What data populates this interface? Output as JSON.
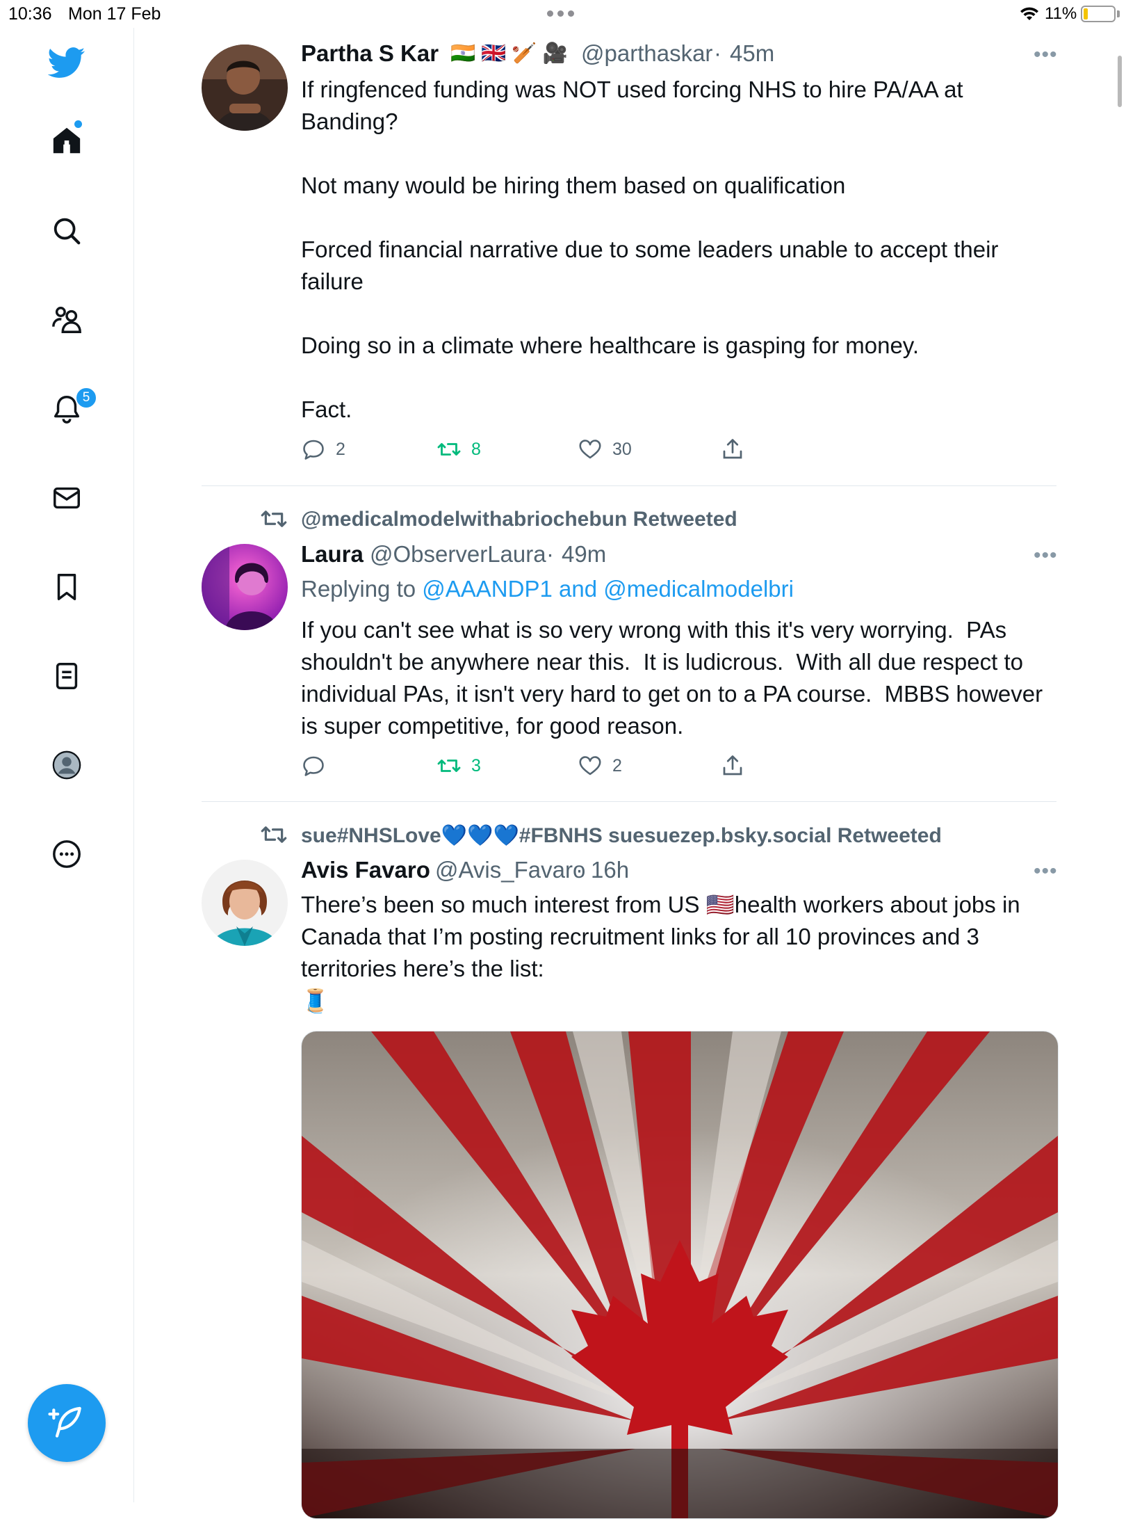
{
  "status_bar": {
    "time": "10:36",
    "date": "Mon 17 Feb",
    "battery": "11%"
  },
  "sidebar": {
    "items": [
      {
        "name": "home-icon"
      },
      {
        "name": "search-icon"
      },
      {
        "name": "communities-icon"
      },
      {
        "name": "notifications-icon",
        "badge": "5"
      },
      {
        "name": "messages-icon"
      },
      {
        "name": "bookmarks-icon"
      },
      {
        "name": "lists-icon"
      },
      {
        "name": "profile-icon"
      },
      {
        "name": "more-icon"
      }
    ],
    "notification_badge": "5"
  },
  "tweets": [
    {
      "name": "Partha S Kar",
      "name_emojis": "🇮🇳 🇬🇧 🏏 🎥",
      "handle": "@parthaskar",
      "time": "45m",
      "text": "If ringfenced funding was NOT used forcing NHS to hire PA/AA at Banding?\n\nNot many would be hiring them based on qualification\n\nForced financial narrative due to some leaders unable to accept their failure\n\nDoing so in a climate where healthcare is gasping for money.\n\nFact.",
      "replies": "2",
      "retweets": "8",
      "likes": "30"
    },
    {
      "retweeted_by": "@medicalmodelwithabriochebun Retweeted",
      "name": "Laura",
      "handle": "@ObserverLaura",
      "time": "49m",
      "replying_prefix": "Replying to ",
      "replying_to": "@AAANDP1 and @medicalmodelbri",
      "text": "If you can't see what is so very wrong with this it's very worrying.  PAs shouldn't be anywhere near this.  It is ludicrous.  With all due respect to individual PAs, it isn't very hard to get on to a PA course.  MBBS however is super competitive, for good reason.",
      "replies": "",
      "retweets": "3",
      "likes": "2"
    },
    {
      "retweeted_by": "sue#NHSLove💙💙💙#FBNHS suesuezep.bsky.social Retweeted",
      "name": "Avis Favaro",
      "handle": "@Avis_Favaro",
      "time": "16h",
      "text_a": "There’s been so much interest from US ",
      "text_flag": "🇺🇸",
      "text_b": "health workers about jobs in Canada that I’m posting recruitment links for all 10 provinces and 3 territories here’s the list:",
      "text_emoji": "🧵"
    }
  ],
  "separator": "·",
  "colors": {
    "accent": "#1d9bf0",
    "retweet_green": "#00ba7c",
    "secondary_text": "#536471"
  }
}
